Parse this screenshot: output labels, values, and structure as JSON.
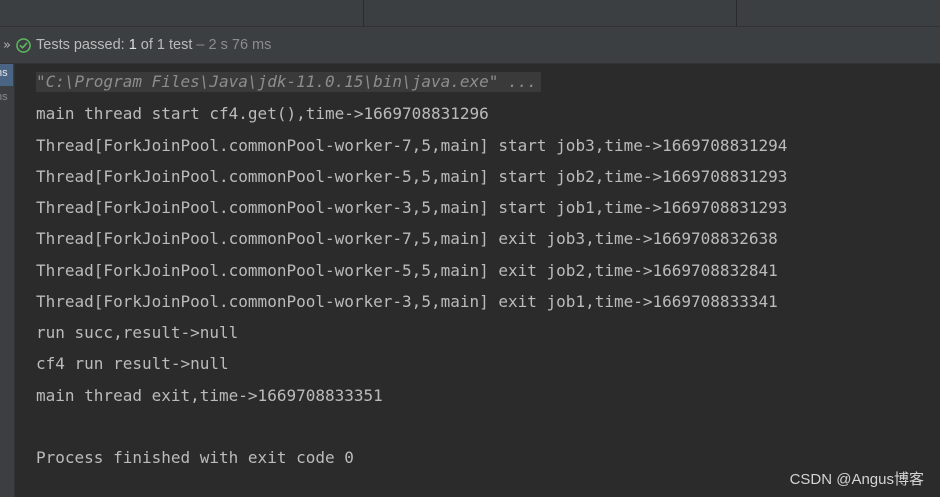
{
  "status": {
    "prefix": "Tests passed: ",
    "count": "1",
    "of_total": " of 1 test",
    "duration": " – 2 s 76 ms",
    "expand_glyph": "»",
    "icon": "check-circle-icon",
    "accent": "#5fb85f"
  },
  "gutter": {
    "tab1": "ns",
    "tab2": "ns"
  },
  "console": {
    "lines": [
      "\"C:\\Program Files\\Java\\jdk-11.0.15\\bin\\java.exe\" ...",
      "main thread start cf4.get(),time->1669708831296",
      "Thread[ForkJoinPool.commonPool-worker-7,5,main] start job3,time->1669708831294",
      "Thread[ForkJoinPool.commonPool-worker-5,5,main] start job2,time->1669708831293",
      "Thread[ForkJoinPool.commonPool-worker-3,5,main] start job1,time->1669708831293",
      "Thread[ForkJoinPool.commonPool-worker-7,5,main] exit job3,time->1669708832638",
      "Thread[ForkJoinPool.commonPool-worker-5,5,main] exit job2,time->1669708832841",
      "Thread[ForkJoinPool.commonPool-worker-3,5,main] exit job1,time->1669708833341",
      "run succ,result->null",
      "cf4 run result->null",
      "main thread exit,time->1669708833351",
      "Process finished with exit code 0"
    ]
  },
  "watermark": "CSDN @Angus博客"
}
